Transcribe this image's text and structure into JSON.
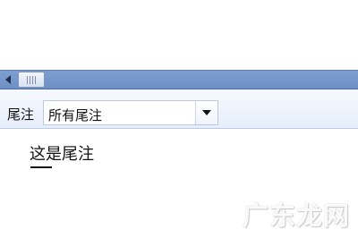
{
  "footnote_pane": {
    "label": "尾注",
    "dropdown": {
      "selected": "所有尾注"
    },
    "note_text": "这是尾注"
  },
  "watermark": {
    "text": "广东龙网"
  },
  "icons": {
    "scroll_left": "left-arrow-icon",
    "dropdown_arrow": "chevron-down-icon"
  },
  "colors": {
    "scrollbar": "#7e9fd1",
    "toolbar_background": "#e6eefb"
  }
}
